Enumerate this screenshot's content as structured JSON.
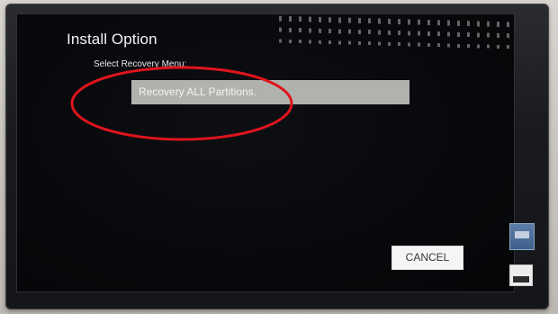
{
  "dialog": {
    "title": "Install Option",
    "subtitle": "Select Recovery Menu:",
    "options": [
      {
        "label": "Recovery ALL Partitions."
      }
    ],
    "cancel_label": "CANCEL"
  },
  "colors": {
    "screen_background": "#08090c",
    "option_background": "#b0b2ae",
    "button_background": "#f4f5f4",
    "annotation_stroke": "#e0141c"
  }
}
